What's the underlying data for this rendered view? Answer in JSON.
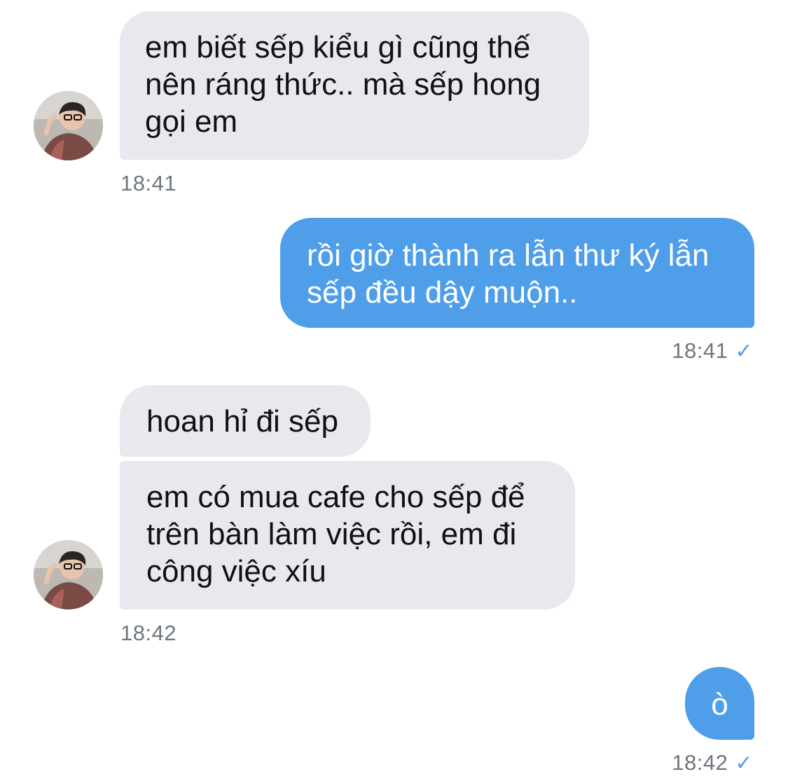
{
  "colors": {
    "incoming_bubble": "#e8e9ee",
    "outgoing_bubble": "#4f9ee9",
    "timestamp": "#6f7680",
    "read_check": "#4f9ee9"
  },
  "messages": [
    {
      "direction": "incoming",
      "text": "em biết sếp kiểu gì cũng thế\nnên ráng thức.. mà sếp hong\ngọi em",
      "time": "18:41"
    },
    {
      "direction": "outgoing",
      "text": "rồi giờ thành ra lẫn thư ký lẫn\nsếp đều dậy muộn..",
      "time": "18:41",
      "status_icon": "check-icon"
    },
    {
      "direction": "incoming",
      "text": "hoan hỉ đi sếp"
    },
    {
      "direction": "incoming",
      "text": "em có mua cafe cho sếp để\ntrên bàn làm việc rồi, em đi\ncông việc xíu",
      "time": "18:42"
    },
    {
      "direction": "outgoing",
      "text": "ò",
      "time": "18:42",
      "status_icon": "check-icon"
    }
  ],
  "check_glyph": "✓"
}
